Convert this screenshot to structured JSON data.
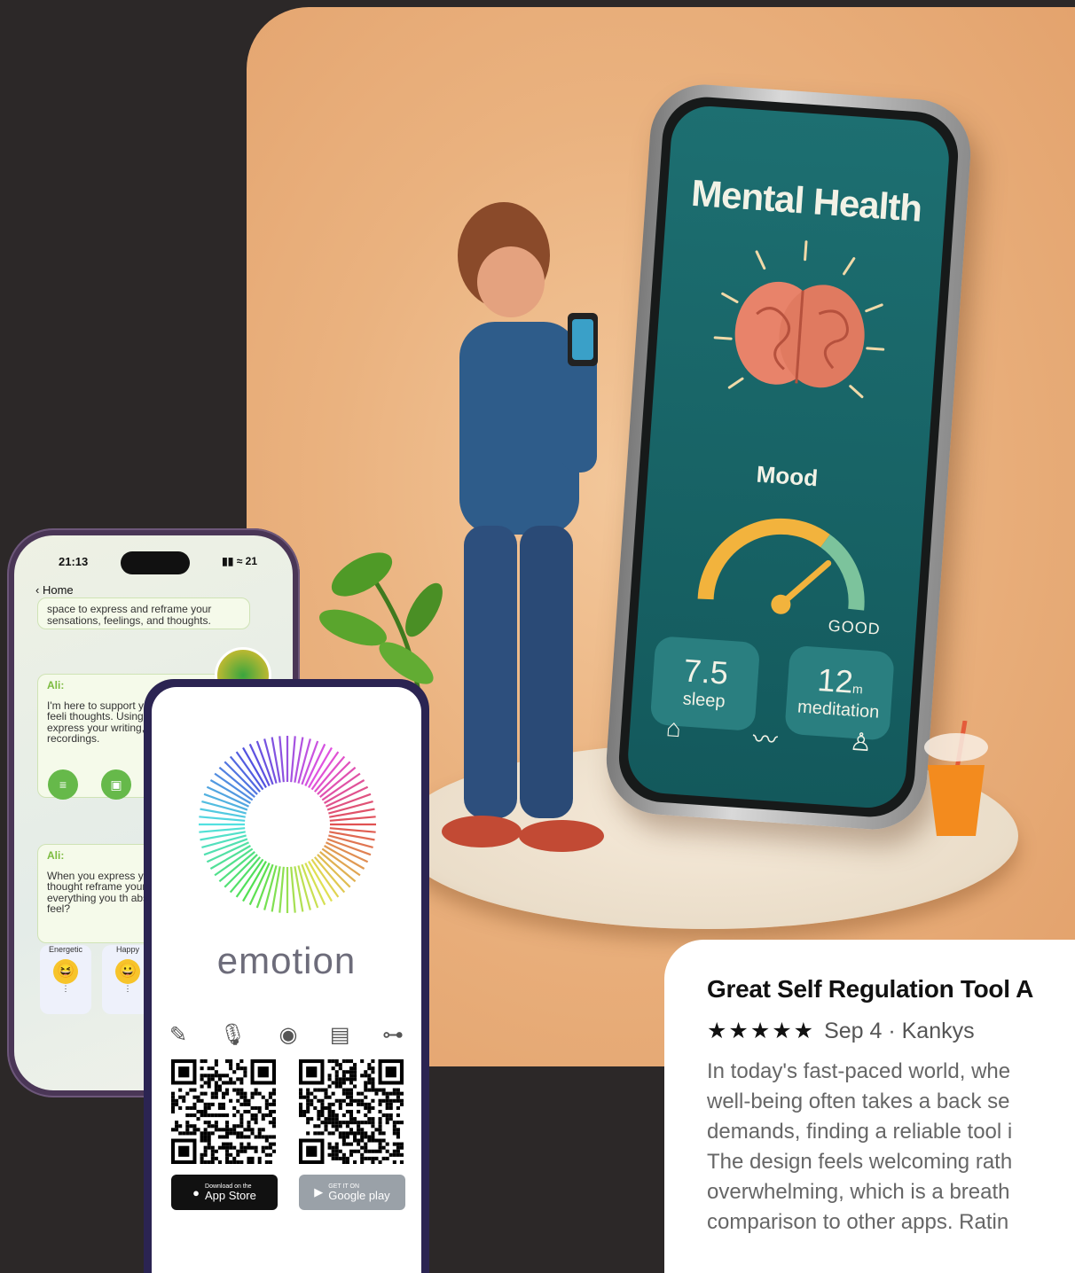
{
  "hero": {
    "app_title": "Mental Health",
    "mood_label": "Mood",
    "gauge_label": "GOOD",
    "stats": [
      {
        "value": "7.5",
        "label": "sleep"
      },
      {
        "value": "12",
        "unit": "m",
        "label": "meditation"
      }
    ],
    "nav_icons": [
      "home-icon",
      "trend-icon",
      "profile-icon"
    ]
  },
  "chat_phone": {
    "time": "21:13",
    "back_label": "Home",
    "battery": "21",
    "messages": [
      {
        "text": "space to express and reframe your sensations, feelings, and thoughts."
      },
      {
        "sender": "Ali:",
        "text": "I'm here to support yo your sensations, feeli thoughts. Using the ic you can express your writing, images, or ev recordings."
      },
      {
        "sender": "Ali:",
        "text": "When you express yo feelings, and thought reframe your ideas a Not everything you th absolute truth. How w feel?"
      }
    ],
    "moods": [
      {
        "label": "Energetic",
        "face": "😆"
      },
      {
        "label": "Happy",
        "face": "😀"
      }
    ]
  },
  "emotion_card": {
    "brand": "emotion",
    "app_store_sub": "Download on the",
    "app_store": "App Store",
    "play_sub": "GET IT ON",
    "play": "Google play"
  },
  "review": {
    "title": "Great Self Regulation Tool A",
    "stars": "★★★★★",
    "meta": "Sep 4 · Kankys",
    "lines": [
      "In today's fast-paced world, whe",
      "well-being often takes a back se",
      "demands, finding a reliable tool i",
      "The design feels welcoming rath",
      "overwhelming, which is a breath",
      "comparison to other apps. Ratin"
    ]
  }
}
